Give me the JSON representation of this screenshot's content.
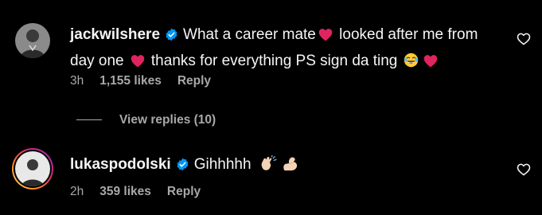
{
  "comments": [
    {
      "username": "jackwilshere",
      "verified": true,
      "text_parts": [
        "What a career mate",
        "looked after me from",
        "day one",
        "thanks for everything PS sign da ting"
      ],
      "time": "3h",
      "likes": "1,155 likes",
      "reply_label": "Reply",
      "view_replies_label": "View replies (10)"
    },
    {
      "username": "lukaspodolski",
      "verified": true,
      "text_parts": [
        "Gihhhhh"
      ],
      "time": "2h",
      "likes": "359 likes",
      "reply_label": "Reply",
      "has_story_ring": true
    }
  ],
  "icons": {
    "verified": "verified-badge-icon",
    "like": "heart-outline-icon",
    "emoji_heart": "red-heart-emoji",
    "emoji_laugh": "tears-of-joy-emoji",
    "emoji_clap": "clapping-hands-emoji",
    "emoji_muscle": "flexed-biceps-emoji"
  },
  "colors": {
    "background": "#000000",
    "text": "#f5f5f5",
    "secondary": "#a8a8a8",
    "verified": "#0095f6",
    "heart_emoji": "#e0245e"
  }
}
